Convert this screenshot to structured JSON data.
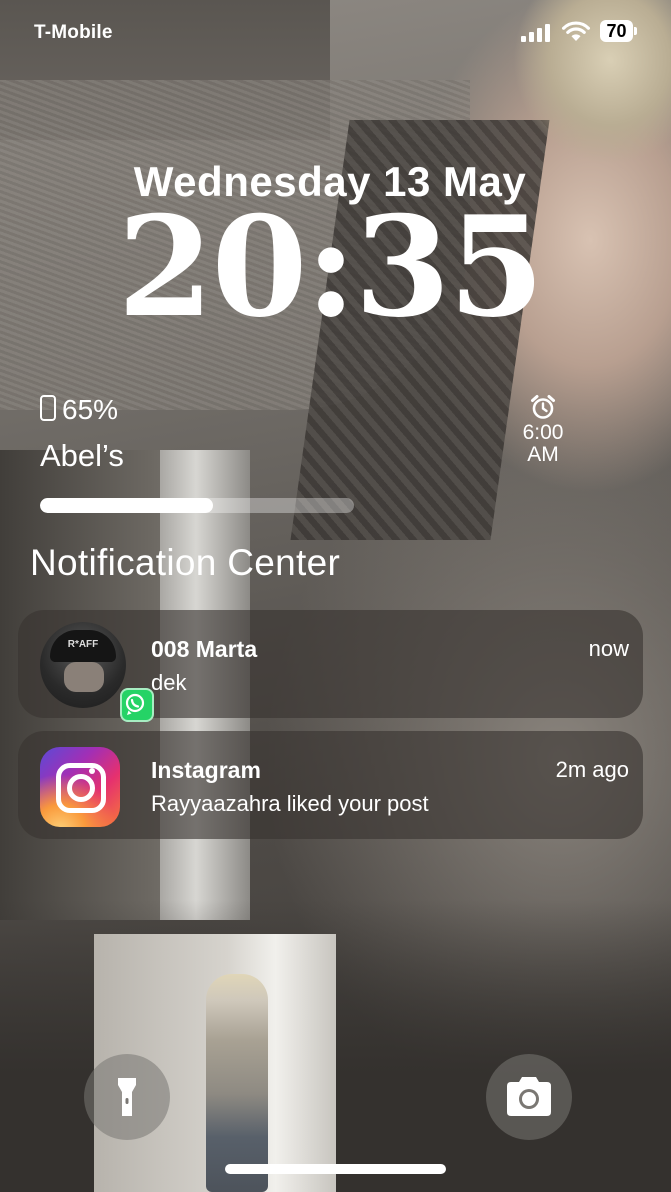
{
  "status_bar": {
    "carrier": "T-Mobile",
    "battery_level": "70",
    "icons": [
      "signal-icon",
      "wifi-icon",
      "battery-icon"
    ]
  },
  "lock_screen": {
    "date": "Wednesday 13 May",
    "time": "20:35"
  },
  "battery_widget": {
    "percent_label": "65%",
    "device_name": "Abel’s",
    "level": 0.55,
    "icon": "phone-battery-icon"
  },
  "alarm_widget": {
    "time": "6:00",
    "period": "AM",
    "icon": "alarm-clock-icon"
  },
  "notification_center": {
    "title": "Notification Center",
    "notifications": [
      {
        "app": "WhatsApp",
        "sender": "008 Marta",
        "message": "dek",
        "time": "now",
        "icon": "contact-avatar",
        "badge_icon": "whatsapp-icon",
        "badge_color": "#25d366"
      },
      {
        "app": "Instagram",
        "sender": "Instagram",
        "message": "Rayyaazahra liked your post",
        "time": "2m ago",
        "icon": "instagram-icon"
      }
    ]
  },
  "bottom_controls": {
    "left_icon": "flashlight-icon",
    "right_icon": "camera-icon"
  }
}
